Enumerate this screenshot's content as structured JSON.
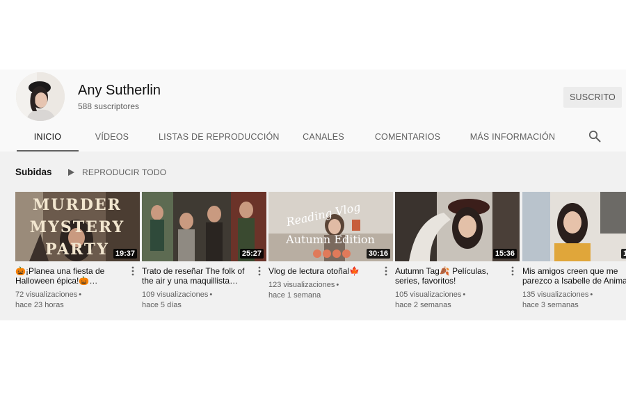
{
  "channel": {
    "name": "Any Sutherlin",
    "subscribers": "588 suscriptores",
    "subscribe_label": "SUSCRITO"
  },
  "tabs": [
    {
      "label": "INICIO",
      "active": true
    },
    {
      "label": "VÍDEOS",
      "active": false
    },
    {
      "label": "LISTAS DE REPRODUCCIÓN",
      "active": false
    },
    {
      "label": "CANALES",
      "active": false
    },
    {
      "label": "COMENTARIOS",
      "active": false
    },
    {
      "label": "MÁS INFORMACIÓN",
      "active": false
    }
  ],
  "shelf": {
    "title": "Subidas",
    "play_all_label": "REPRODUCIR TODO"
  },
  "videos": [
    {
      "title": "🎃¡Planea una fiesta de Halloween épica!🎃…",
      "duration": "19:37",
      "views": "72 visualizaciones",
      "age": "hace 23 horas",
      "thumb_text": [
        "MURDER",
        "MYSTERY",
        "PARTY"
      ]
    },
    {
      "title": "Trato de reseñar The folk of the air y una maquillista…",
      "duration": "25:27",
      "views": "109 visualizaciones",
      "age": "hace 5 días"
    },
    {
      "title": "Vlog de lectura otoñal🍁",
      "duration": "30:16",
      "views": "123 visualizaciones",
      "age": "hace 1 semana",
      "thumb_text": [
        "Reading Vlog",
        "Autumn Edition"
      ]
    },
    {
      "title": "Autumn Tag🍂 Películas, series, favoritos!",
      "duration": "15:36",
      "views": "105 visualizaciones",
      "age": "hace 2 semanas"
    },
    {
      "title": "Mis amigos creen que me parezco a Isabelle de Animal…",
      "duration": "1",
      "views": "135 visualizaciones",
      "age": "hace 3 semanas"
    }
  ],
  "colors": {
    "header_bg": "#f9f9f9",
    "content_bg": "#f1f1f1",
    "tab_underline": "#606060"
  }
}
